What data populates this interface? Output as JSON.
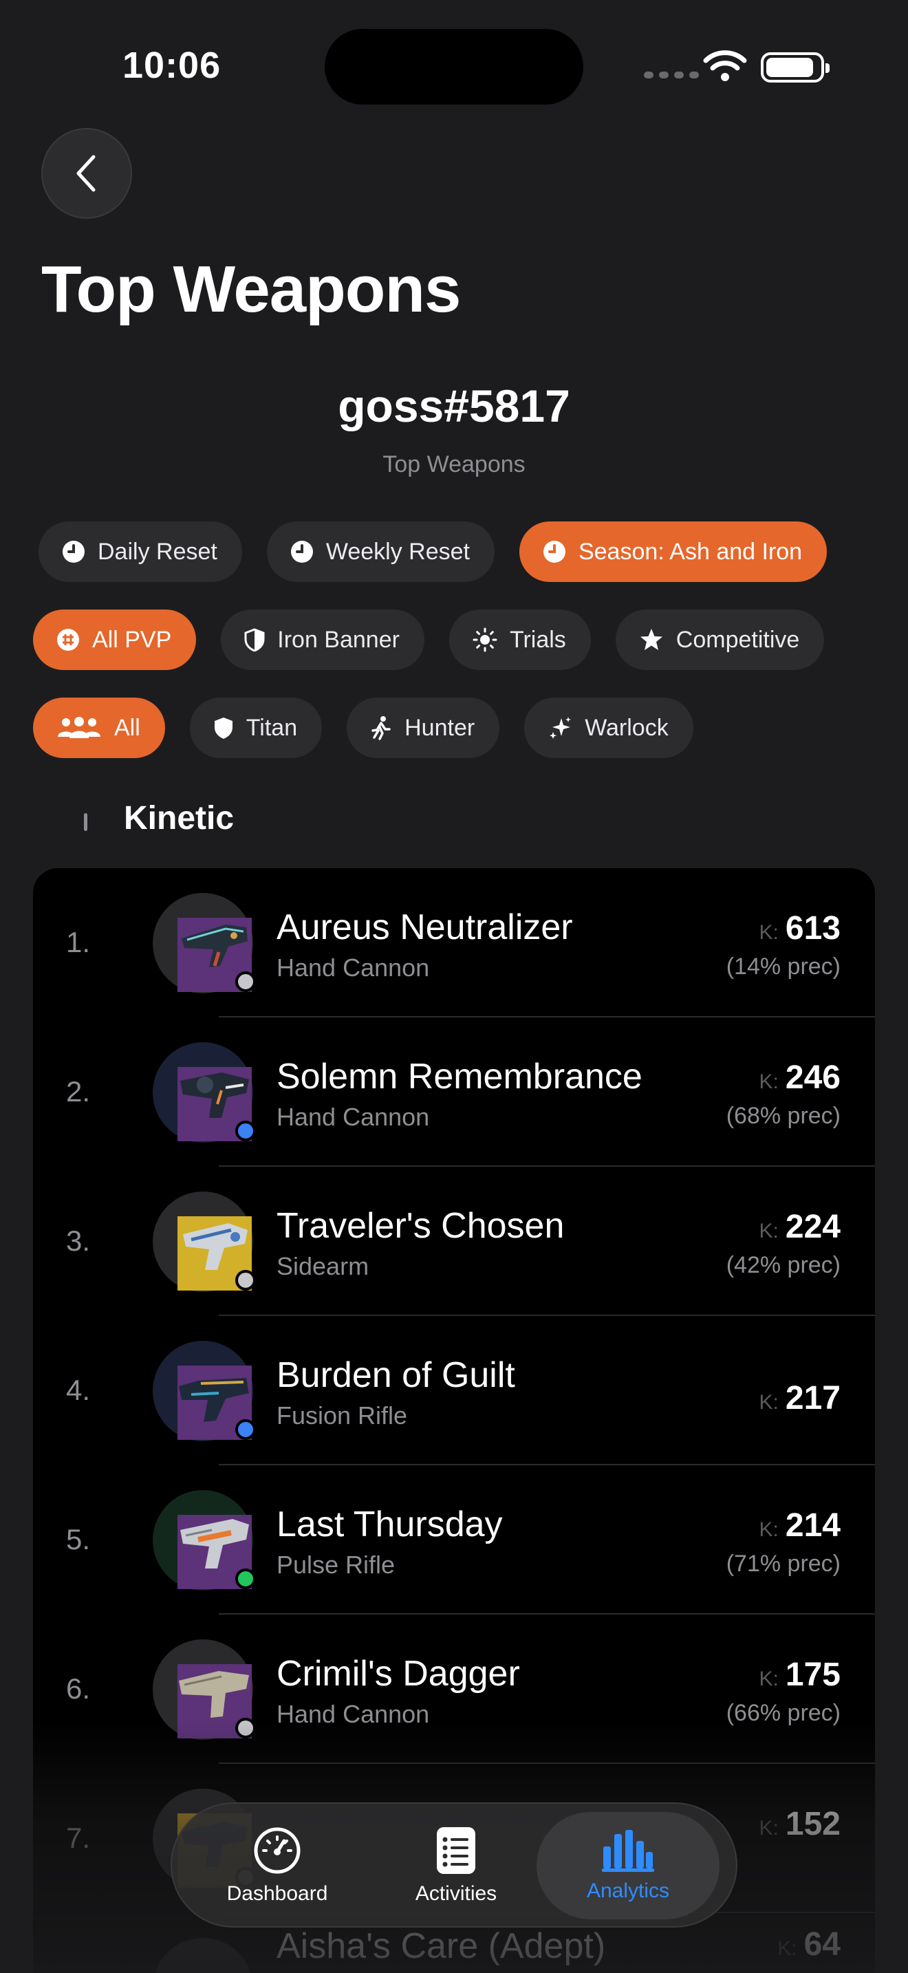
{
  "status_bar": {
    "time": "10:06"
  },
  "header": {
    "title": "Top Weapons"
  },
  "profile": {
    "username": "goss#5817",
    "subtitle": "Top Weapons"
  },
  "time_filters": [
    {
      "label": "Daily Reset",
      "icon": "clock-icon",
      "active": false
    },
    {
      "label": "Weekly Reset",
      "icon": "clock-icon",
      "active": false
    },
    {
      "label": "Season: Ash and Iron",
      "icon": "clock-icon",
      "active": true
    }
  ],
  "mode_filters": [
    {
      "label": "All PVP",
      "icon": "crosshair-icon",
      "active": true
    },
    {
      "label": "Iron Banner",
      "icon": "shield-icon",
      "active": false
    },
    {
      "label": "Trials",
      "icon": "sun-icon",
      "active": false
    },
    {
      "label": "Competitive",
      "icon": "star-icon",
      "active": false
    }
  ],
  "class_filters": [
    {
      "label": "All",
      "icon": "people-icon",
      "active": true
    },
    {
      "label": "Titan",
      "icon": "titan-icon",
      "active": false
    },
    {
      "label": "Hunter",
      "icon": "hunter-icon",
      "active": false
    },
    {
      "label": "Warlock",
      "icon": "warlock-icon",
      "active": false
    }
  ],
  "section": {
    "title": "Kinetic"
  },
  "weapons": [
    {
      "rank": "1.",
      "name": "Aureus Neutralizer",
      "type": "Hand Cannon",
      "k_label": "K:",
      "kills": "613",
      "precision": "(14% prec)",
      "rarity_color": "#c7c7cc"
    },
    {
      "rank": "2.",
      "name": "Solemn Remembrance",
      "type": "Hand Cannon",
      "k_label": "K:",
      "kills": "246",
      "precision": "(68% prec)",
      "rarity_color": "#3b82f6"
    },
    {
      "rank": "3.",
      "name": "Traveler's Chosen",
      "type": "Sidearm",
      "k_label": "K:",
      "kills": "224",
      "precision": "(42% prec)",
      "rarity_color": "#c7c7cc"
    },
    {
      "rank": "4.",
      "name": "Burden of Guilt",
      "type": "Fusion Rifle",
      "k_label": "K:",
      "kills": "217",
      "precision": "",
      "rarity_color": "#3b82f6"
    },
    {
      "rank": "5.",
      "name": "Last Thursday",
      "type": "Pulse Rifle",
      "k_label": "K:",
      "kills": "214",
      "precision": "(71% prec)",
      "rarity_color": "#22c55e"
    },
    {
      "rank": "6.",
      "name": "Crimil's Dagger",
      "type": "Hand Cannon",
      "k_label": "K:",
      "kills": "175",
      "precision": "(66% prec)",
      "rarity_color": "#c7c7cc"
    },
    {
      "rank": "7.",
      "name": "",
      "type": "",
      "k_label": "K:",
      "kills": "152",
      "precision": "",
      "rarity_color": "#c7c7cc"
    },
    {
      "rank": "",
      "name": "Aisha's Care (Adept)",
      "type": "",
      "k_label": "K:",
      "kills": "64",
      "precision": "",
      "rarity_color": "#c7c7cc"
    }
  ],
  "tabbar": {
    "tabs": [
      {
        "label": "Dashboard",
        "icon": "speedometer-icon",
        "active": false
      },
      {
        "label": "Activities",
        "icon": "list-icon",
        "active": false
      },
      {
        "label": "Analytics",
        "icon": "bar-chart-icon",
        "active": true
      }
    ]
  },
  "colors": {
    "accent": "#e5672b",
    "tab_active": "#2f8cff",
    "background": "#1c1c1e"
  }
}
